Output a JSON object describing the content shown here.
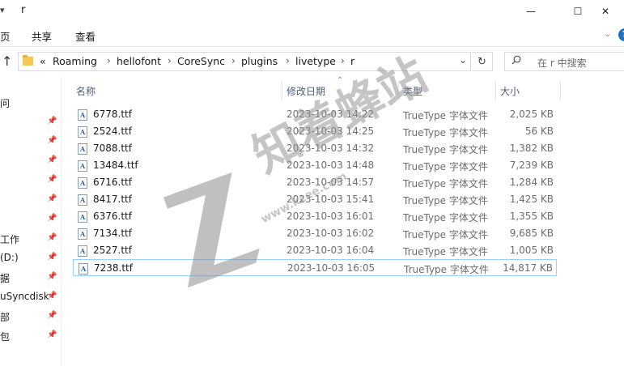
{
  "window": {
    "title": "r",
    "controls": {
      "minimize": "—",
      "maximize": "☐",
      "close": "✕"
    }
  },
  "ribbon": {
    "tabs": [
      "页",
      "共享",
      "查看"
    ],
    "expand_icon": "chevron-down-icon",
    "help_label": "?"
  },
  "address": {
    "overflow": "«",
    "segments": [
      "Roaming",
      "hellofont",
      "CoreSync",
      "plugins",
      "livetype",
      "r"
    ],
    "separator": "›",
    "dropdown": "⌄",
    "refresh": "↻",
    "search_placeholder": "在 r 中搜索"
  },
  "nav": {
    "items": [
      {
        "label": "问",
        "pinned": false
      },
      {
        "label": "",
        "pinned": true
      },
      {
        "label": "",
        "pinned": true
      },
      {
        "label": "",
        "pinned": true
      },
      {
        "label": "",
        "pinned": true
      },
      {
        "label": "",
        "pinned": true
      },
      {
        "label": "",
        "pinned": true
      },
      {
        "label": "工作",
        "pinned": true
      },
      {
        "label": "(D:)",
        "pinned": true
      },
      {
        "label": "据",
        "pinned": true
      },
      {
        "label": "uSyncdisk",
        "pinned": true
      },
      {
        "label": "部",
        "pinned": true
      },
      {
        "label": "包",
        "pinned": true
      }
    ]
  },
  "columns": {
    "name": "名称",
    "date": "修改日期",
    "type": "类型",
    "size": "大小"
  },
  "files": [
    {
      "name": "6778.ttf",
      "date": "2023-10-03 14:22",
      "type": "TrueType 字体文件",
      "size": "2,025 KB"
    },
    {
      "name": "2524.ttf",
      "date": "2023-10-03 14:25",
      "type": "TrueType 字体文件",
      "size": "56 KB"
    },
    {
      "name": "7088.ttf",
      "date": "2023-10-03 14:32",
      "type": "TrueType 字体文件",
      "size": "1,382 KB"
    },
    {
      "name": "13484.ttf",
      "date": "2023-10-03 14:48",
      "type": "TrueType 字体文件",
      "size": "7,239 KB"
    },
    {
      "name": "6716.ttf",
      "date": "2023-10-03 14:57",
      "type": "TrueType 字体文件",
      "size": "1,284 KB"
    },
    {
      "name": "8417.ttf",
      "date": "2023-10-03 15:41",
      "type": "TrueType 字体文件",
      "size": "1,425 KB"
    },
    {
      "name": "6376.ttf",
      "date": "2023-10-03 16:01",
      "type": "TrueType 字体文件",
      "size": "1,355 KB"
    },
    {
      "name": "7134.ttf",
      "date": "2023-10-03 16:02",
      "type": "TrueType 字体文件",
      "size": "9,685 KB"
    },
    {
      "name": "2527.ttf",
      "date": "2023-10-03 16:04",
      "type": "TrueType 字体文件",
      "size": "1,005 KB"
    },
    {
      "name": "7238.ttf",
      "date": "2023-10-03 16:05",
      "type": "TrueType 字体文件",
      "size": "14,817 KB"
    }
  ],
  "selected_file_index": 9,
  "watermark": {
    "text": "知着蜂站",
    "url": "www.kcee.com"
  },
  "colors": {
    "selection_border": "#99d1ff",
    "header_text": "#4c607a",
    "folder": "#f3c55a"
  }
}
